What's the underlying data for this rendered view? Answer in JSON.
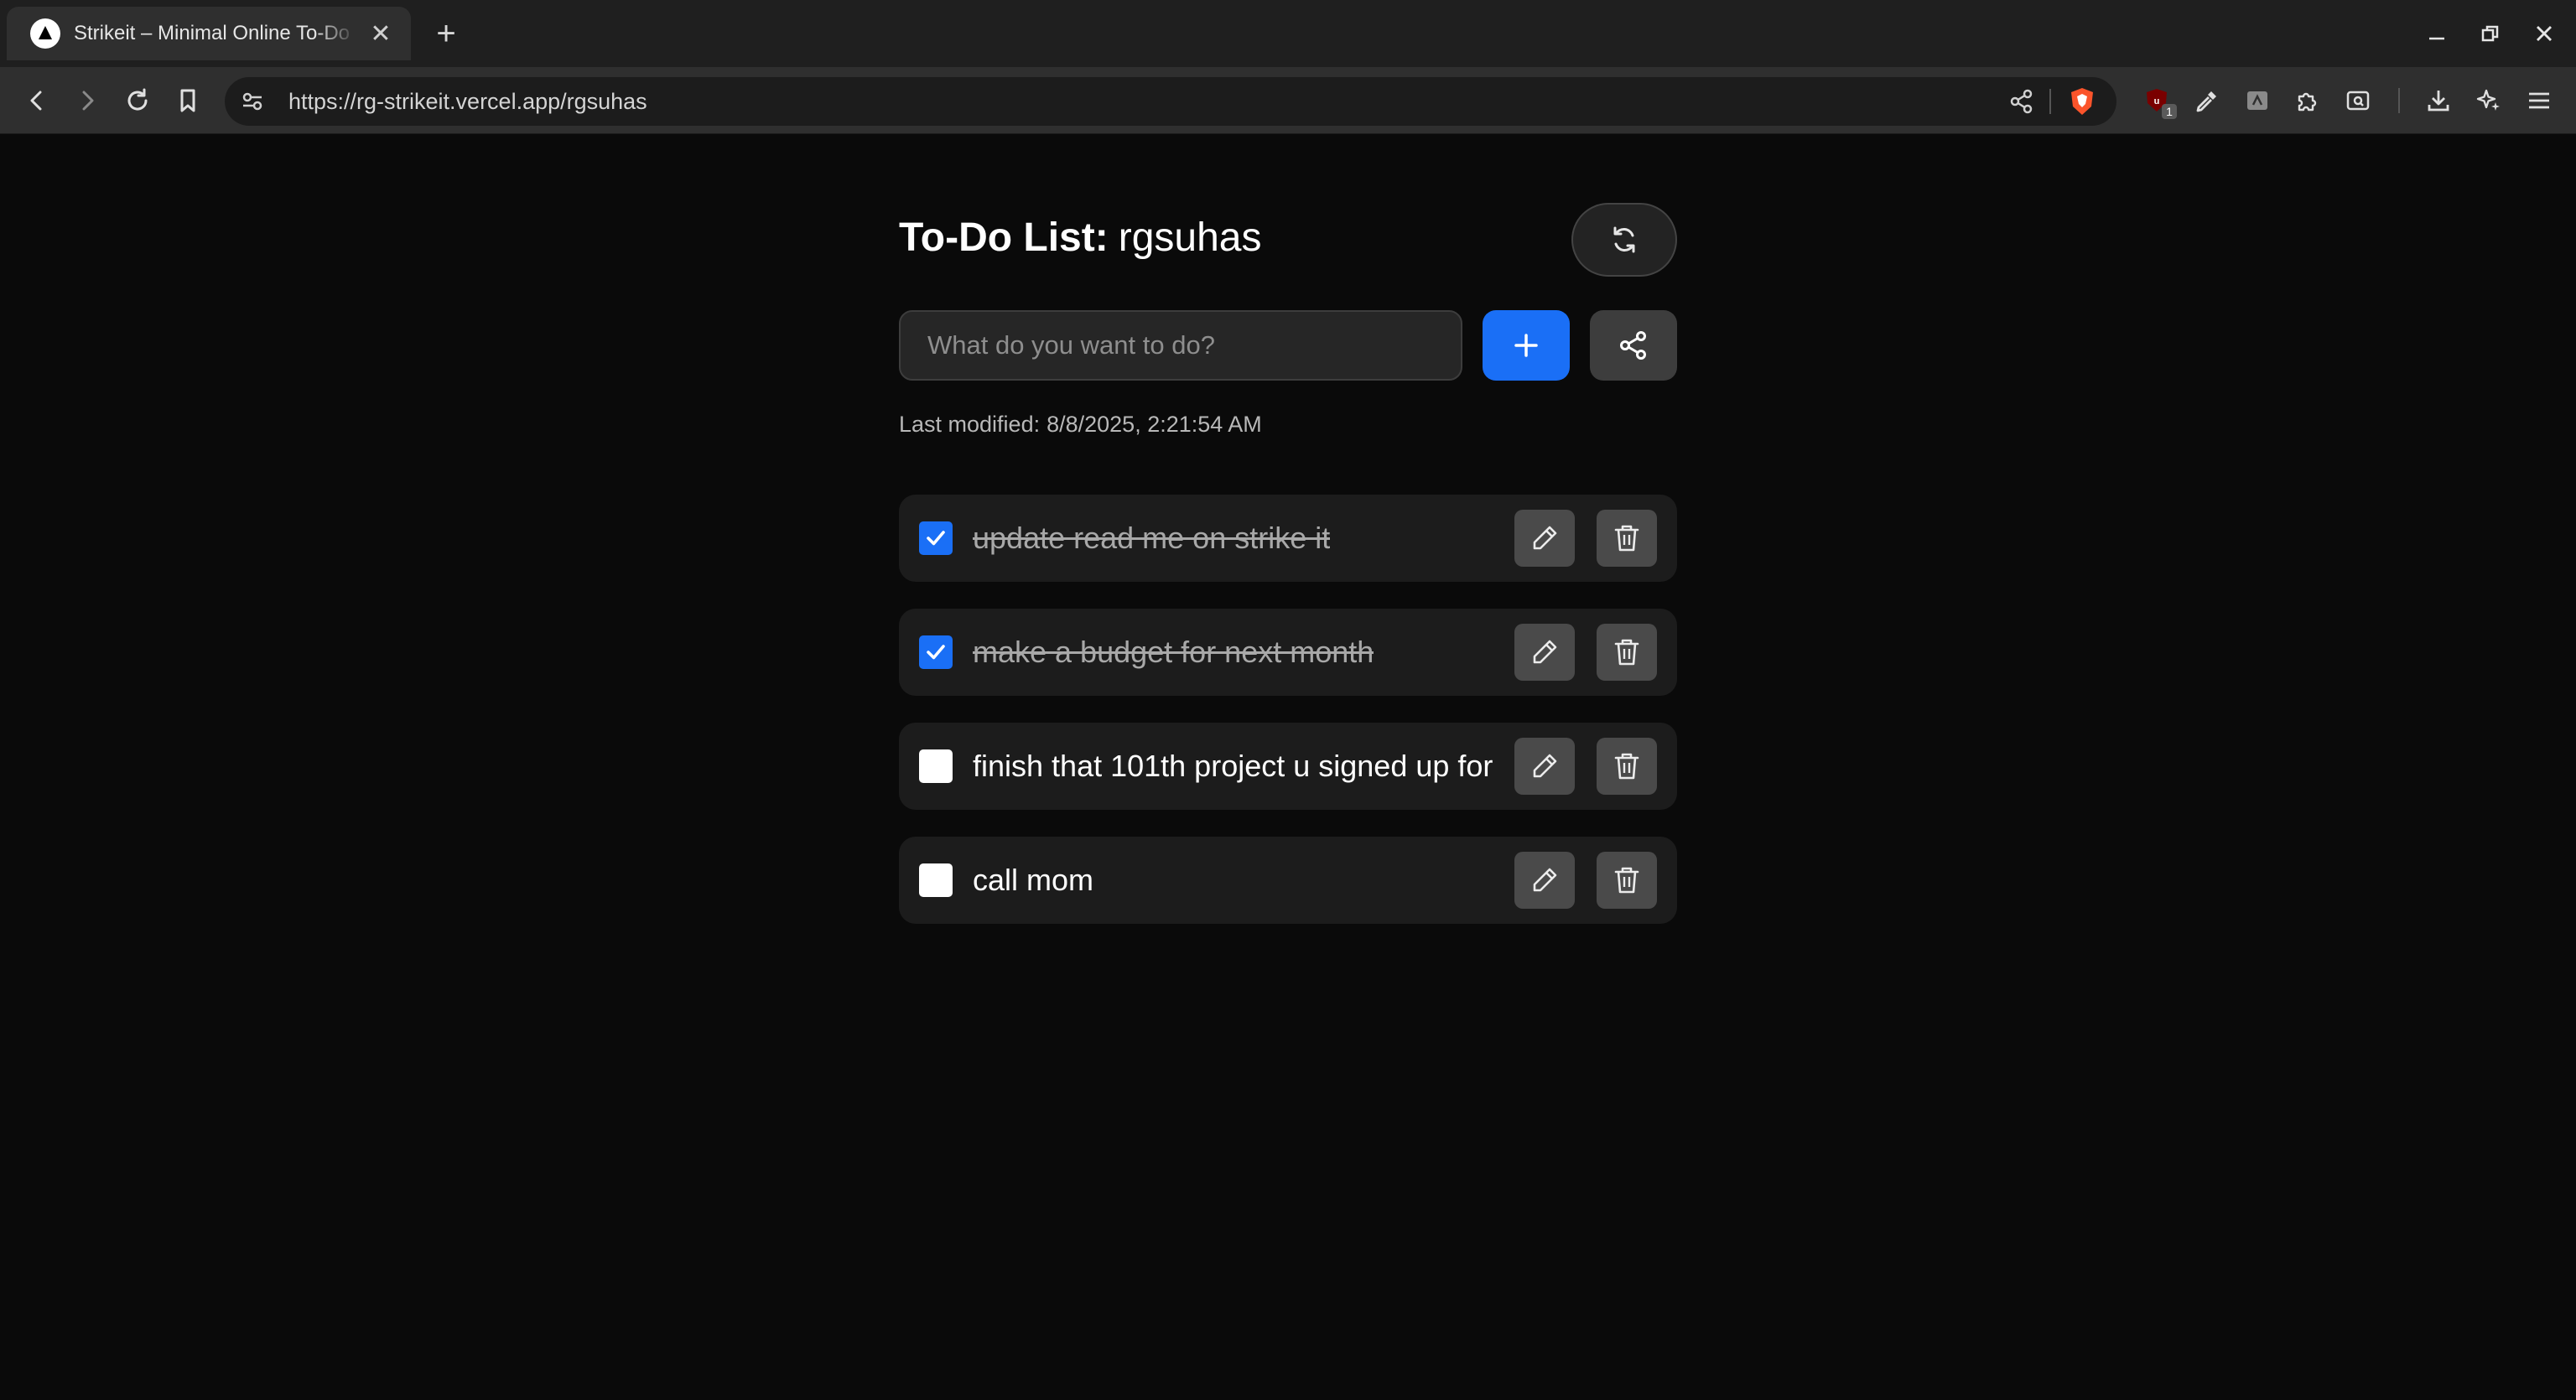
{
  "browser": {
    "tab_title": "Strikeit – Minimal Online To-Do List",
    "url": "https://rg-strikeit.vercel.app/rgsuhas",
    "extension_badge": "1"
  },
  "app": {
    "title_prefix": "To-Do List:",
    "username": "rgsuhas",
    "input_placeholder": "What do you want to do?",
    "last_modified_label": "Last modified:",
    "last_modified_value": "8/8/2025, 2:21:54 AM",
    "accent_color": "#1a6ff6",
    "items": [
      {
        "text": "update read me on strike it",
        "done": true
      },
      {
        "text": "make a budget for next month",
        "done": true
      },
      {
        "text": "finish that 101th project u signed up for",
        "done": false
      },
      {
        "text": "call mom",
        "done": false
      }
    ]
  }
}
